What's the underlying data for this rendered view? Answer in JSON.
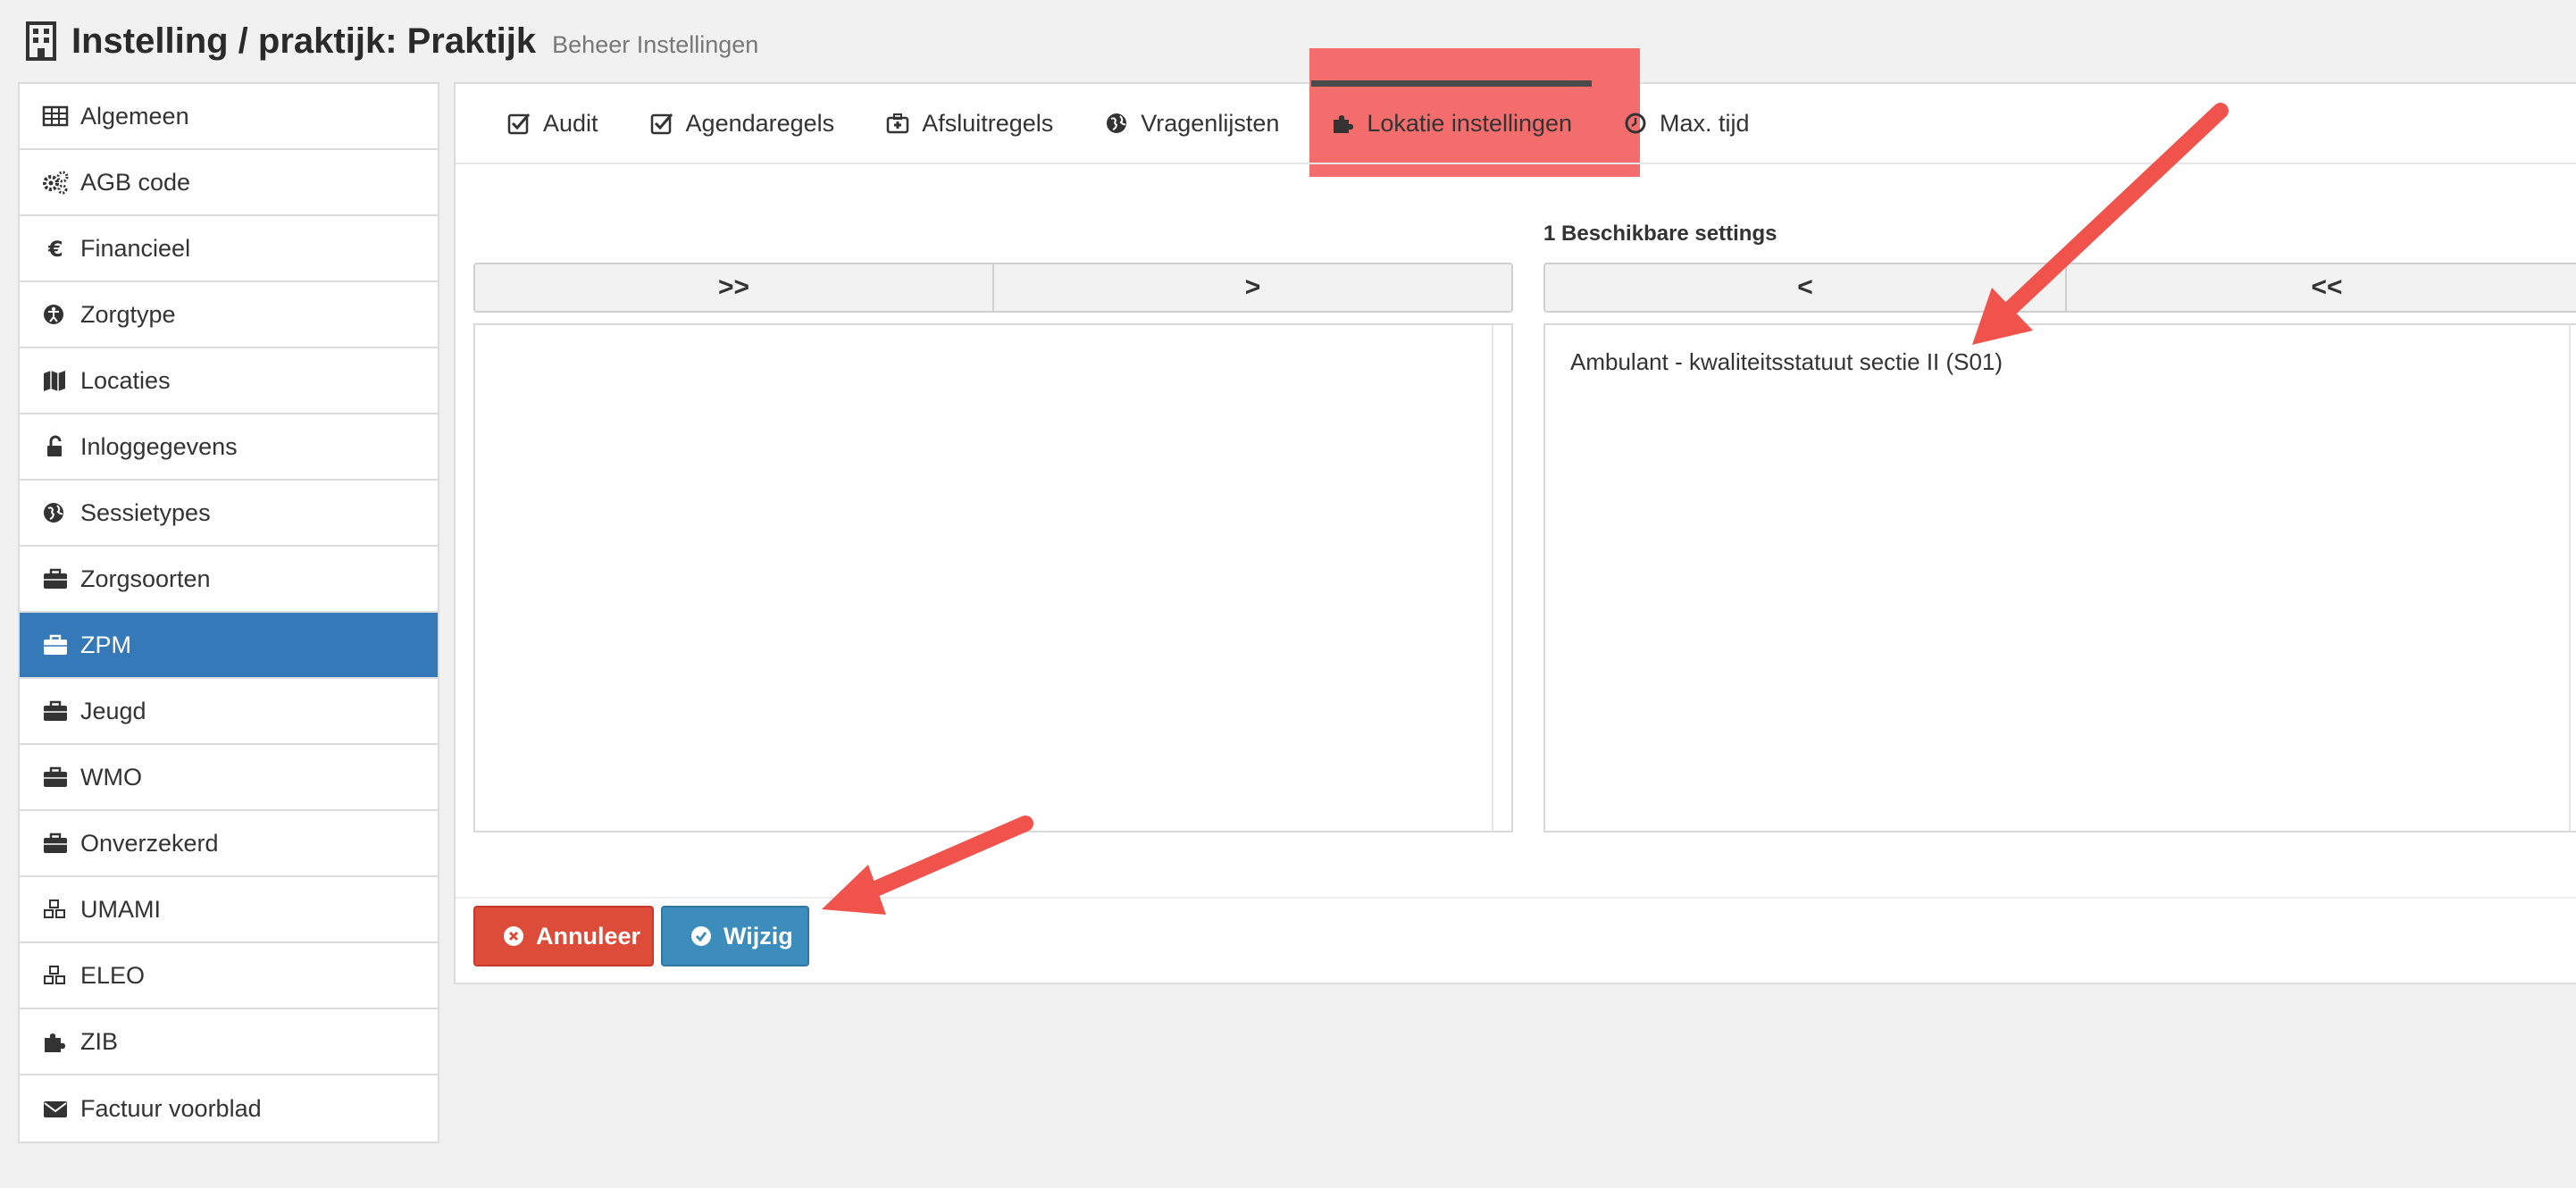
{
  "header": {
    "title": "Instelling / praktijk: Praktijk",
    "subtitle": "Beheer Instellingen"
  },
  "sidebar": {
    "items": [
      {
        "label": "Algemeen",
        "icon": "table-icon"
      },
      {
        "label": "AGB code",
        "icon": "gears-icon"
      },
      {
        "label": "Financieel",
        "icon": "euro-icon"
      },
      {
        "label": "Zorgtype",
        "icon": "accessibility-icon"
      },
      {
        "label": "Locaties",
        "icon": "map-icon"
      },
      {
        "label": "Inloggegevens",
        "icon": "unlock-icon"
      },
      {
        "label": "Sessietypes",
        "icon": "globe-icon"
      },
      {
        "label": "Zorgsoorten",
        "icon": "briefcase-icon"
      },
      {
        "label": "ZPM",
        "icon": "briefcase-icon",
        "active": true
      },
      {
        "label": "Jeugd",
        "icon": "briefcase-icon"
      },
      {
        "label": "WMO",
        "icon": "briefcase-icon"
      },
      {
        "label": "Onverzekerd",
        "icon": "briefcase-icon"
      },
      {
        "label": "UMAMI",
        "icon": "cubes-icon"
      },
      {
        "label": "ELEO",
        "icon": "cubes-icon"
      },
      {
        "label": "ZIB",
        "icon": "puzzle-icon"
      },
      {
        "label": "Factuur voorblad",
        "icon": "envelope-icon"
      }
    ]
  },
  "tabs": [
    {
      "label": "Audit",
      "icon": "check-square-icon"
    },
    {
      "label": "Agendaregels",
      "icon": "check-square-icon"
    },
    {
      "label": "Afsluitregels",
      "icon": "medkit-icon"
    },
    {
      "label": "Vragenlijsten",
      "icon": "globe-icon"
    },
    {
      "label": "Lokatie instellingen",
      "icon": "puzzle-icon",
      "active": true
    },
    {
      "label": "Max. tijd",
      "icon": "clock-icon"
    }
  ],
  "available": {
    "label": "1 Beschikbare settings",
    "items": [
      "Ambulant - kwaliteitsstatuut sectie II (S01)"
    ]
  },
  "move_buttons": {
    "move_all_right": ">>",
    "move_right": ">",
    "move_left": "<",
    "move_all_left": "<<"
  },
  "actions": {
    "cancel_label": "Annuleer",
    "save_label": "Wijzig"
  },
  "colors": {
    "active_blue": "#3579b8",
    "cancel_red": "#dd4b39",
    "save_blue": "#3c8dbc",
    "highlight_red": "#f36d6d",
    "arrow_red": "#f0524c"
  }
}
